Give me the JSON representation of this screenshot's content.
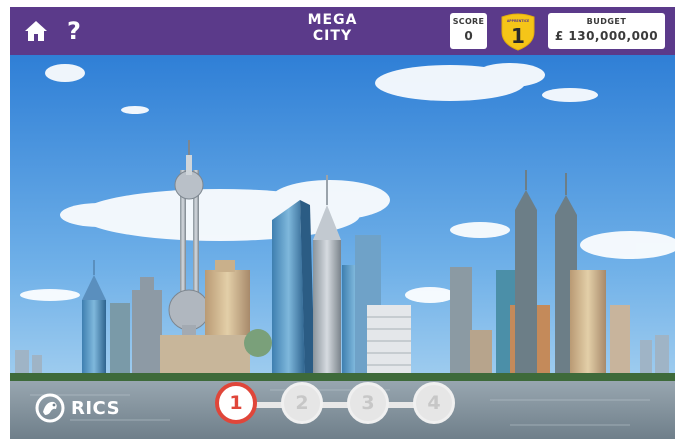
{
  "header": {
    "title_line1": "MEGA",
    "title_line2": "CITY",
    "score_label": "SCORE",
    "score_value": "0",
    "rank_label": "APPRENTICE",
    "rank_number": "1",
    "budget_label": "BUDGET",
    "budget_value": "£ 130,000,000",
    "help_label": "?"
  },
  "footer": {
    "logo_text": "RICS",
    "steps": [
      "1",
      "2",
      "3",
      "4"
    ],
    "active_step": 1
  },
  "icons": {
    "home": "home-icon",
    "help": "question-mark-icon",
    "rank": "shield-badge-icon",
    "logo": "lion-emblem-icon"
  },
  "colors": {
    "header_bg": "#5b3a8a",
    "badge_gold": "#f5c518",
    "active_step": "#e0463a",
    "inactive_step": "#e6e6e6"
  }
}
